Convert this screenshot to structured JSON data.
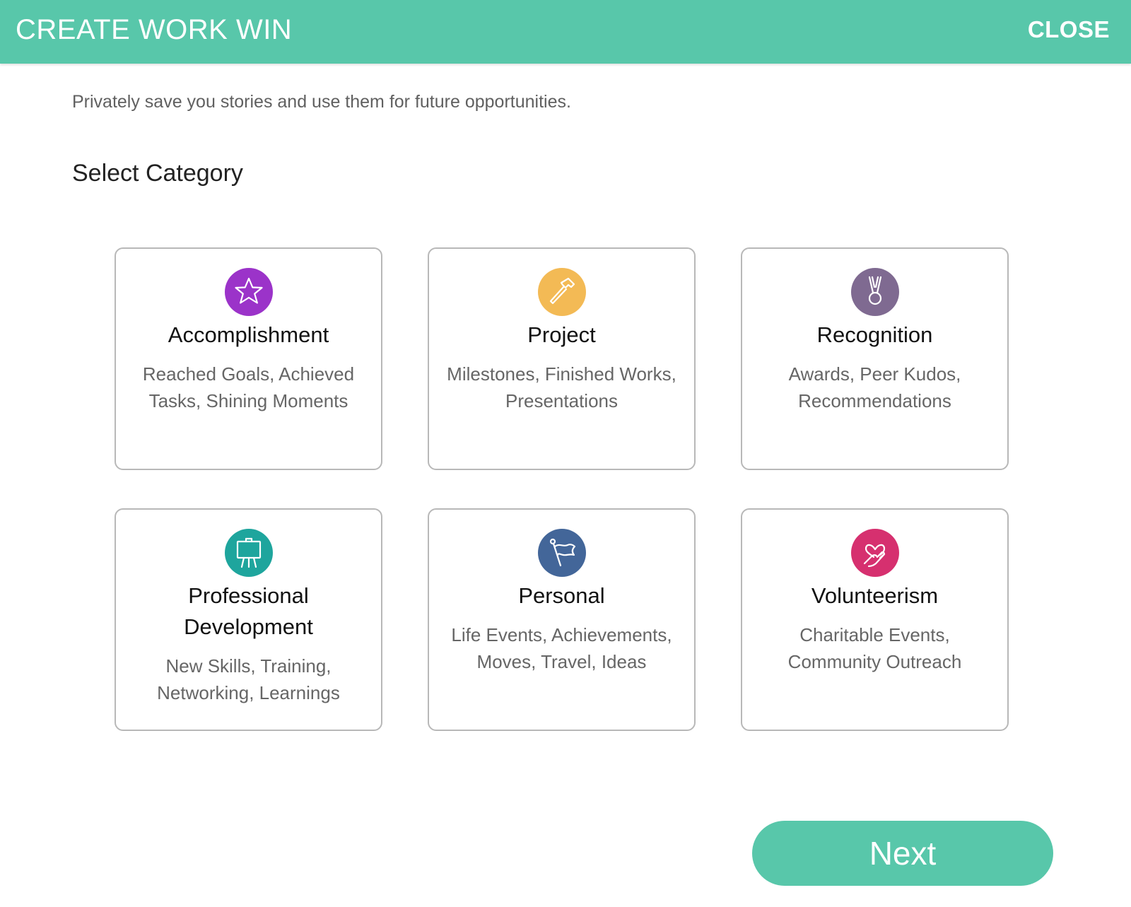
{
  "header": {
    "title": "CREATE WORK WIN",
    "close_label": "CLOSE",
    "background_color": "#58c7aa"
  },
  "intro": {
    "subtitle": "Privately save you stories and use them for future opportunities.",
    "section_title": "Select Category"
  },
  "categories": [
    {
      "name": "Accomplishment",
      "description": "Reached Goals, Achieved Tasks, Shining Moments",
      "icon": "star-icon",
      "color": "#9b33c9"
    },
    {
      "name": "Project",
      "description": "Milestones, Finished Works, Presentations",
      "icon": "hammer-icon",
      "color": "#f3ba55"
    },
    {
      "name": "Recognition",
      "description": "Awards, Peer Kudos, Recommendations",
      "icon": "medal-icon",
      "color": "#7f6a91"
    },
    {
      "name": "Professional Development",
      "description": "New Skills, Training, Networking, Learnings",
      "icon": "easel-icon",
      "color": "#1ea59d"
    },
    {
      "name": "Personal",
      "description": "Life Events, Achievements, Moves, Travel, Ideas",
      "icon": "flag-icon",
      "color": "#436699"
    },
    {
      "name": "Volunteerism",
      "description": "Charitable Events, Community Outreach",
      "icon": "heart-hand-icon",
      "color": "#d6306f"
    }
  ],
  "footer": {
    "next_label": "Next"
  }
}
